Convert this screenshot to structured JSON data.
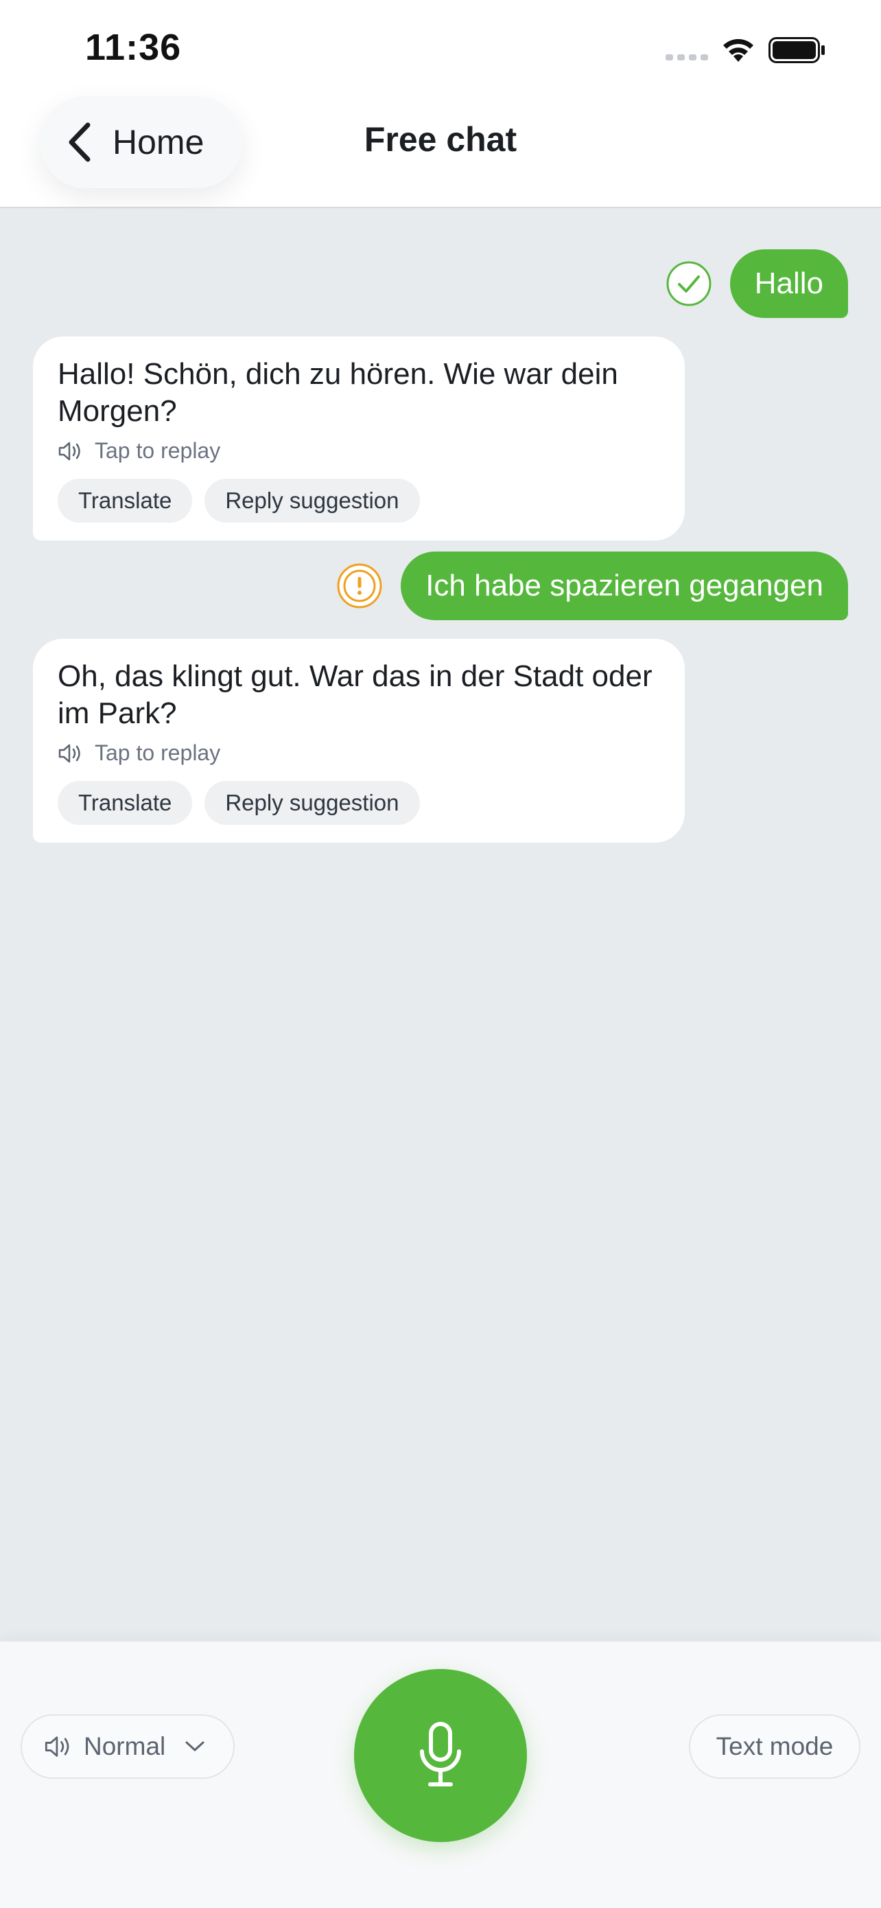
{
  "status_bar": {
    "time": "11:36"
  },
  "nav": {
    "back_label": "Home",
    "title": "Free chat"
  },
  "messages": [
    {
      "role": "user",
      "text": "Hallo",
      "status": "correct",
      "status_icon": "check-circle-icon",
      "status_color": "#55b73c"
    },
    {
      "role": "assistant",
      "text": "Hallo! Schön, dich zu hören. Wie war dein Morgen?",
      "replay_label": "Tap to replay",
      "actions": [
        "Translate",
        "Reply suggestion"
      ]
    },
    {
      "role": "user",
      "text": "Ich habe spazieren gegangen",
      "status": "warning",
      "status_icon": "warning-circle-icon",
      "status_color": "#f0a020"
    },
    {
      "role": "assistant",
      "text": "Oh, das klingt gut. War das in der Stadt oder im Park?",
      "replay_label": "Tap to replay",
      "actions": [
        "Translate",
        "Reply suggestion"
      ]
    }
  ],
  "bottom_bar": {
    "speed_label": "Normal",
    "text_mode_label": "Text mode"
  },
  "colors": {
    "accent": "#55b73c",
    "warning": "#f0a020",
    "chat_background": "#e8ebee"
  }
}
